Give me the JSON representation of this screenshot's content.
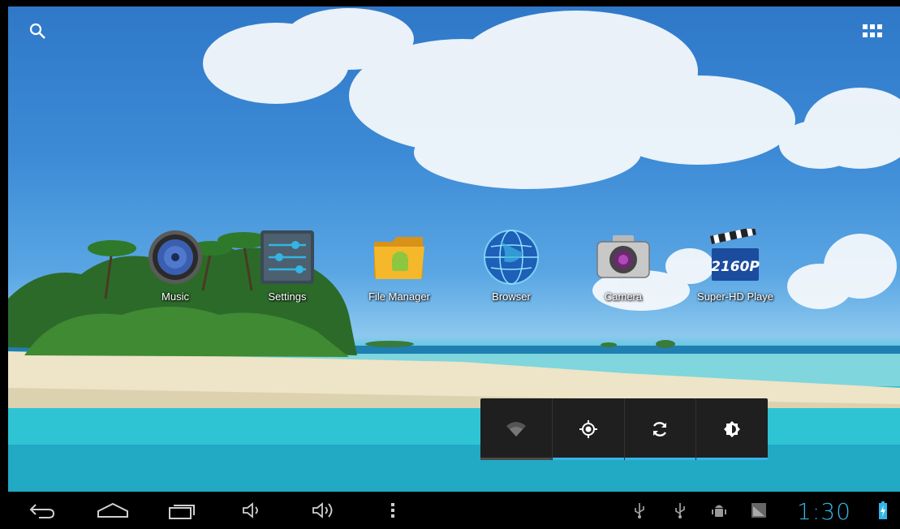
{
  "apps": [
    {
      "label": "Music",
      "icon": "music-speaker-icon"
    },
    {
      "label": "Settings",
      "icon": "settings-sliders-icon"
    },
    {
      "label": "File Manager",
      "icon": "folder-android-icon"
    },
    {
      "label": "Browser",
      "icon": "globe-icon"
    },
    {
      "label": "Camera",
      "icon": "camera-icon"
    },
    {
      "label": "Super-HD Playe",
      "icon": "clapperboard-icon",
      "badge": "2160P"
    }
  ],
  "quick_settings": [
    {
      "name": "wifi",
      "icon": "wifi-icon",
      "active": false
    },
    {
      "name": "location",
      "icon": "location-icon",
      "active": true
    },
    {
      "name": "auto-rotate",
      "icon": "sync-icon",
      "active": true
    },
    {
      "name": "brightness",
      "icon": "brightness-icon",
      "active": true
    }
  ],
  "status": {
    "time": "1:30"
  },
  "colors": {
    "accent": "#33b5e5",
    "navbar": "#000000",
    "panel": "#1f1f1f"
  }
}
